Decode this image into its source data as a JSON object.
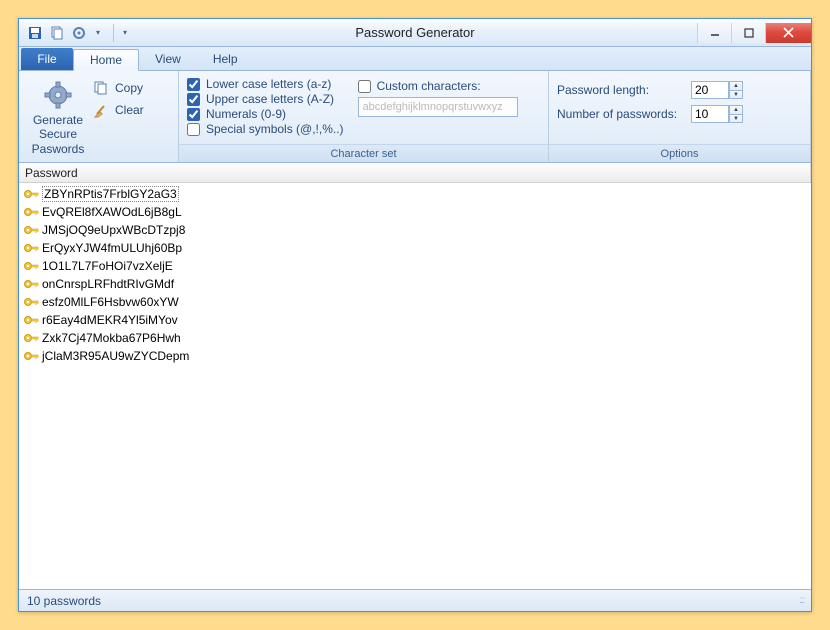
{
  "title": "Password Generator",
  "tabs": {
    "file": "File",
    "home": "Home",
    "view": "View",
    "help": "Help"
  },
  "ribbon": {
    "generate": {
      "label": "Generate",
      "big": "Generate\nSecure\nPaswords",
      "copy": "Copy",
      "clear": "Clear"
    },
    "charset": {
      "label": "Character set",
      "lower": "Lower case letters (a-z)",
      "upper": "Upper case letters (A-Z)",
      "numerals": "Numerals (0-9)",
      "special": "Special symbols (@,!,%..)",
      "custom": "Custom characters:",
      "custom_placeholder": "abcdefghijklmnopqrstuvwxyz"
    },
    "options": {
      "label": "Options",
      "len_label": "Password length:",
      "len_value": "20",
      "num_label": "Number of passwords:",
      "num_value": "10"
    }
  },
  "list": {
    "header": "Password",
    "rows": [
      "ZBYnRPtis7FrblGY2aG3",
      "EvQREl8fXAWOdL6jB8gL",
      "JMSjOQ9eUpxWBcDTzpj8",
      "ErQyxYJW4fmULUhj60Bp",
      "1O1L7L7FoHOi7vzXeljE",
      "onCnrspLRFhdtRIvGMdf",
      "esfz0MlLF6Hsbvw60xYW",
      "r6Eay4dMEKR4Yl5iMYov",
      "Zxk7Cj47Mokba67P6Hwh",
      "jClaM3R95AU9wZYCDepm"
    ]
  },
  "status": "10 passwords"
}
